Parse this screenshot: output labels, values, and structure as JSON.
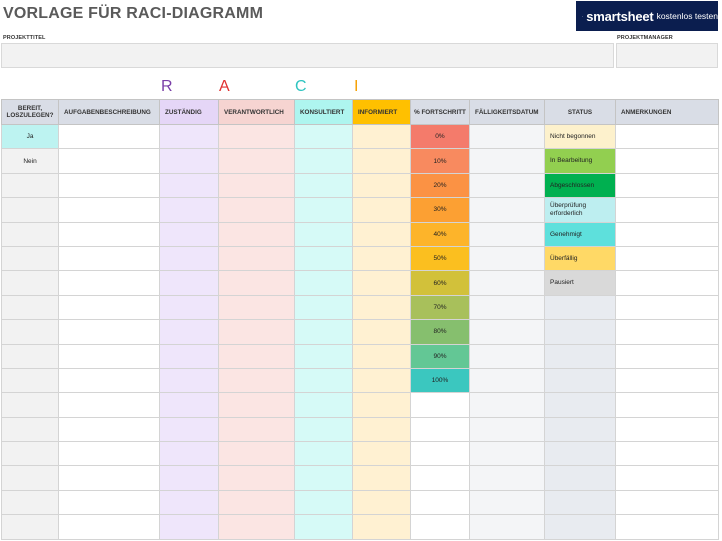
{
  "header": {
    "title": "VORLAGE FÜR RACI-DIAGRAMM",
    "brand_name": "smartsheet",
    "brand_cta": "kostenlos testen"
  },
  "fields": {
    "project_title_label": "PROJEKTTITEL",
    "project_title_value": "",
    "project_manager_label": "PROJEKTMANAGER",
    "project_manager_value": ""
  },
  "raci": {
    "r": "R",
    "a": "A",
    "c": "C",
    "i": "I",
    "colors": {
      "r": "#7a3fa8",
      "a": "#e03131",
      "c": "#2ec4c0",
      "i": "#f59f00"
    }
  },
  "columns": [
    "BEREIT, LOSZULEGEN?",
    "AUFGABENBESCHREIBUNG",
    "ZUSTÄNDIG",
    "VERANTWORTLICH",
    "KONSULTIERT",
    "INFORMIERT",
    "% FORTSCHRITT",
    "FÄLLIGKEITSDATUM",
    "STATUS",
    "ANMERKUNGEN"
  ],
  "ready_options": [
    "Ja",
    "Nein"
  ],
  "progress_options": [
    "0%",
    "10%",
    "20%",
    "30%",
    "40%",
    "50%",
    "60%",
    "70%",
    "80%",
    "90%",
    "100%"
  ],
  "progress_colors": [
    "#f47b6b",
    "#f88a5f",
    "#fb9244",
    "#fca033",
    "#fdb42a",
    "#fbbf1f",
    "#d2c13a",
    "#a8c05b",
    "#86bf6e",
    "#63c795",
    "#3bc7bf"
  ],
  "status_options": [
    "Nicht begonnen",
    "In Bearbeitung",
    "Abgeschlossen",
    "Überprüfung erforderlich",
    "Genehmigt",
    "Überfällig",
    "Pausiert"
  ],
  "status_colors": [
    "#fdf1cc",
    "#92cf50",
    "#00b050",
    "#bdeef0",
    "#5ee0dc",
    "#ffd966",
    "#d9d9d9"
  ],
  "row_count": 17
}
